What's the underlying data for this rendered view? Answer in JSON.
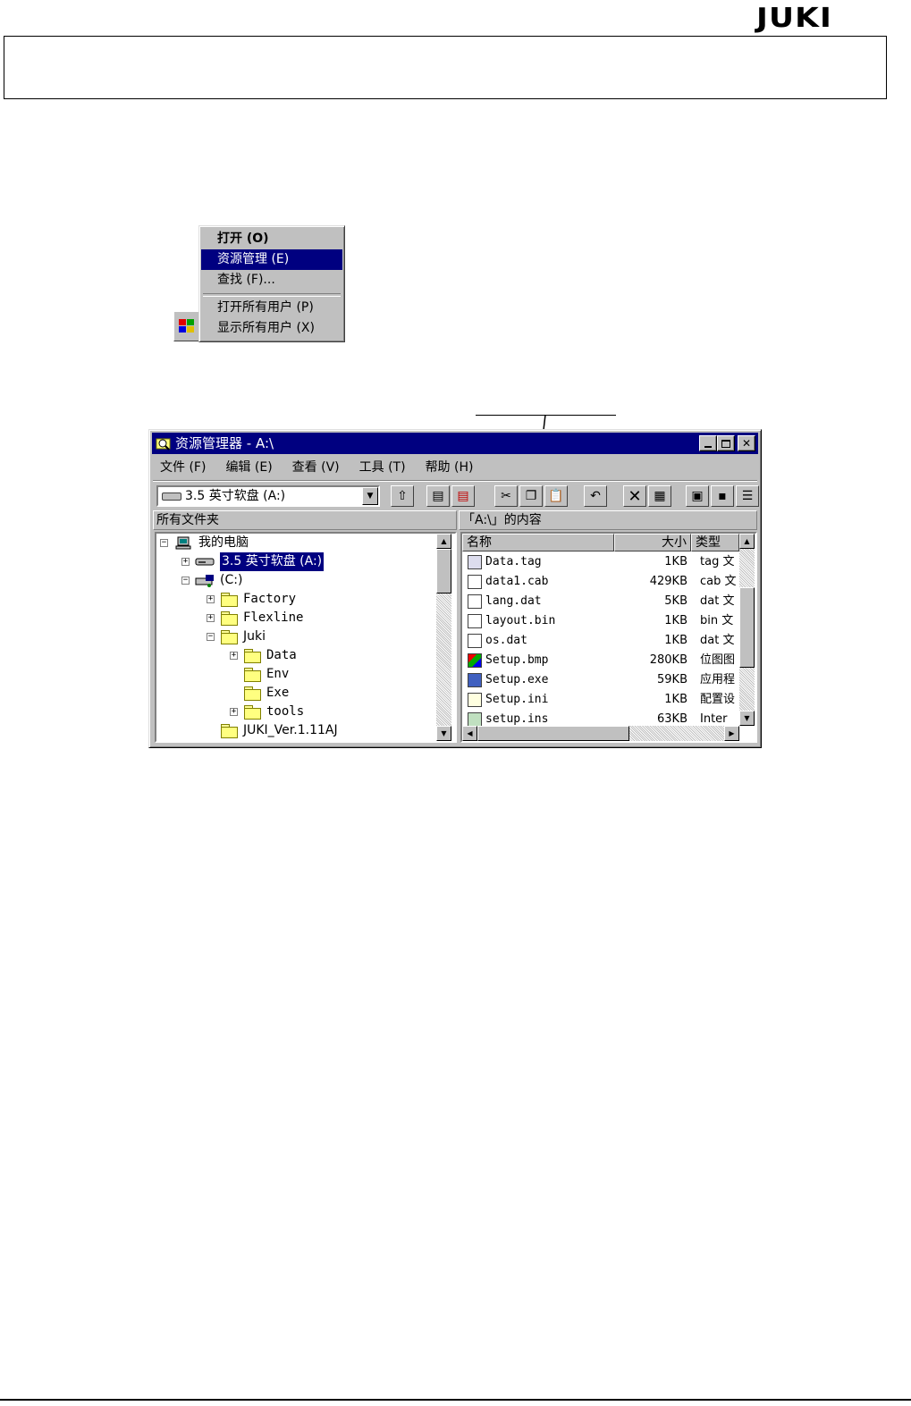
{
  "header": {
    "logo_text": "JUKI"
  },
  "context_menu": {
    "items": [
      {
        "label": "打开 (O)",
        "bold": true
      },
      {
        "label": "资源管理 (E)",
        "selected": true
      },
      {
        "label": "查找 (F)..."
      },
      {
        "label": "打开所有用户 (P)"
      },
      {
        "label": "显示所有用户 (X)"
      }
    ]
  },
  "explorer": {
    "title": "资源管理器 - A:\\",
    "menu": [
      "文件 (F)",
      "编辑 (E)",
      "查看 (V)",
      "工具 (T)",
      "帮助 (H)"
    ],
    "drive_combo": "3.5 英寸软盘 (A:)",
    "left_header": "所有文件夹",
    "right_header": "「A:\\」的内容",
    "tree": [
      {
        "label": "我的电脑",
        "toggle": "−"
      },
      {
        "label": "3.5 英寸软盘 (A:)",
        "toggle": "+",
        "selected": true
      },
      {
        "label": "(C:)",
        "toggle": "−"
      },
      {
        "label": "Factory",
        "toggle": "+"
      },
      {
        "label": "Flexline",
        "toggle": "+"
      },
      {
        "label": "Juki",
        "toggle": "−"
      },
      {
        "label": "Data",
        "toggle": "+"
      },
      {
        "label": "Env",
        "toggle": ""
      },
      {
        "label": "Exe",
        "toggle": ""
      },
      {
        "label": "tools",
        "toggle": "+"
      },
      {
        "label": "JUKI_Ver.1.11AJ",
        "toggle": ""
      }
    ],
    "columns": {
      "name": "名称",
      "size": "大小",
      "type": "类型"
    },
    "files": [
      {
        "name": "Data.tag",
        "size": "1KB",
        "type": "tag 文"
      },
      {
        "name": "data1.cab",
        "size": "429KB",
        "type": "cab 文"
      },
      {
        "name": "lang.dat",
        "size": "5KB",
        "type": "dat 文"
      },
      {
        "name": "layout.bin",
        "size": "1KB",
        "type": "bin 文"
      },
      {
        "name": "os.dat",
        "size": "1KB",
        "type": "dat 文"
      },
      {
        "name": "Setup.bmp",
        "size": "280KB",
        "type": "位图图"
      },
      {
        "name": "Setup.exe",
        "size": "59KB",
        "type": "应用程"
      },
      {
        "name": "Setup.ini",
        "size": "1KB",
        "type": "配置设"
      },
      {
        "name": "setup.ins",
        "size": "63KB",
        "type": "Inter"
      }
    ]
  }
}
